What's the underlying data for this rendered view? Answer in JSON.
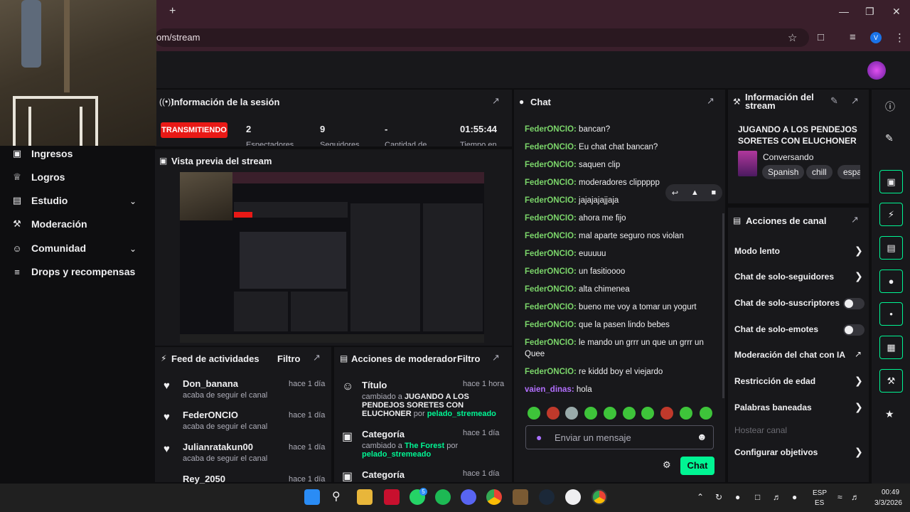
{
  "browser": {
    "url": "om/stream",
    "new_tab_symbol": "+",
    "profile_initial": "V"
  },
  "session": {
    "title": "Información de la sesión",
    "live_label": "TRANSMITIENDO",
    "stats": [
      {
        "value": "2",
        "label": "Espectadores"
      },
      {
        "value": "9",
        "label": "Seguidores"
      },
      {
        "value": "-",
        "label": "Cantidad de"
      },
      {
        "value": "01:55:44",
        "label": "Tiempo en"
      }
    ]
  },
  "preview": {
    "title": "Vista previa del stream"
  },
  "nav": {
    "items": [
      {
        "label": "Ingresos",
        "icon": "money-icon",
        "chevron": false
      },
      {
        "label": "Logros",
        "icon": "trophy-icon",
        "chevron": false
      },
      {
        "label": "Estudio",
        "icon": "studio-icon",
        "chevron": true
      },
      {
        "label": "Moderación",
        "icon": "wrench-icon",
        "chevron": false
      },
      {
        "label": "Comunidad",
        "icon": "community-icon",
        "chevron": true
      },
      {
        "label": "Drops y recompensas",
        "icon": "gift-icon",
        "chevron": false
      }
    ]
  },
  "feed": {
    "title": "Feed de actividades",
    "filter": "Filtro",
    "items": [
      {
        "name": "Don_banana",
        "sub": "acaba de seguir el canal",
        "time": "hace 1 día"
      },
      {
        "name": "FederONCIO",
        "sub": "acaba de seguir el canal",
        "time": "hace 1 día"
      },
      {
        "name": "Julianratakun00",
        "sub": "acaba de seguir el canal",
        "time": "hace 1 día"
      },
      {
        "name": "Rey_2050",
        "sub": "",
        "time": "hace 1 día"
      }
    ]
  },
  "modactions": {
    "title": "Acciones de moderador",
    "filter": "Filtro",
    "items": [
      {
        "title": "Título",
        "time": "hace 1 hora",
        "changed": "cambiado a",
        "value": "JUGANDO A LOS PENDEJOS SORETES CON ELUCHONER",
        "by": "por",
        "user": "pelado_stremeado"
      },
      {
        "title": "Categoría",
        "time": "hace 1 día",
        "changed": "cambiado a",
        "value": "The Forest",
        "by": "por",
        "user": "pelado_stremeado"
      },
      {
        "title": "Categoría",
        "time": "hace 1 día",
        "changed": "",
        "value": "",
        "by": "",
        "user": ""
      }
    ]
  },
  "chat": {
    "title": "Chat",
    "messages": [
      {
        "user": "FederONCIO",
        "text": "bancan?"
      },
      {
        "user": "FederONCIO",
        "text": "Eu chat chat bancan?"
      },
      {
        "user": "FederONCIO",
        "text": "saquen clip"
      },
      {
        "user": "FederONCIO",
        "text": "moderadores clippppp"
      },
      {
        "user": "FederONCIO",
        "text": "jajajajajjaja"
      },
      {
        "user": "FederONCIO",
        "text": "ahora me fijo"
      },
      {
        "user": "FederONCIO",
        "text": "mal aparte seguro nos violan"
      },
      {
        "user": "FederONCIO",
        "text": "euuuuu"
      },
      {
        "user": "FederONCIO",
        "text": "un fasitioooo"
      },
      {
        "user": "FederONCIO",
        "text": "alta chimenea"
      },
      {
        "user": "FederONCIO",
        "text": "bueno me voy a tomar un yogurt"
      },
      {
        "user": "FederONCIO",
        "text": "que la pasen lindo bebes"
      },
      {
        "user": "FederONCIO",
        "text": "le mando un grrr un que un grrr un Quee"
      },
      {
        "user": "FederONCIO",
        "text": "re kiddd boy el viejardo"
      },
      {
        "user": "vaien_dinas",
        "text": "hola"
      }
    ],
    "input_placeholder": "Enviar un mensaje",
    "send_label": "Chat"
  },
  "streaminfo": {
    "title": "Información del stream",
    "stream_title": "JUGANDO A LOS PENDEJOS SORETES CON ELUCHONER",
    "category": "Conversando",
    "tags": [
      "Spanish",
      "chill",
      "espa"
    ]
  },
  "channel_actions": {
    "title": "Acciones de canal",
    "items": [
      {
        "label": "Modo lento",
        "control": "arrow"
      },
      {
        "label": "Chat de solo-seguidores",
        "control": "arrow"
      },
      {
        "label": "Chat de solo-suscriptores",
        "control": "toggle"
      },
      {
        "label": "Chat de solo-emotes",
        "control": "toggle"
      },
      {
        "label": "Moderación del chat con IA",
        "control": "external"
      },
      {
        "label": "Restricción de edad",
        "control": "arrow"
      },
      {
        "label": "Palabras baneadas",
        "control": "arrow"
      },
      {
        "label": "Hostear canal",
        "control": "disabled"
      },
      {
        "label": "Configurar objetivos",
        "control": "arrow"
      }
    ]
  },
  "taskbar": {
    "lang": "ESP",
    "lang2": "ES",
    "time": "00:49",
    "date": "3/3/2026",
    "whatsapp_badge": "5"
  },
  "colors": {
    "accent": "#00f593",
    "live": "#e91916",
    "chat_user": "#7bd56a",
    "chrome_bg": "#3a1f2b"
  }
}
